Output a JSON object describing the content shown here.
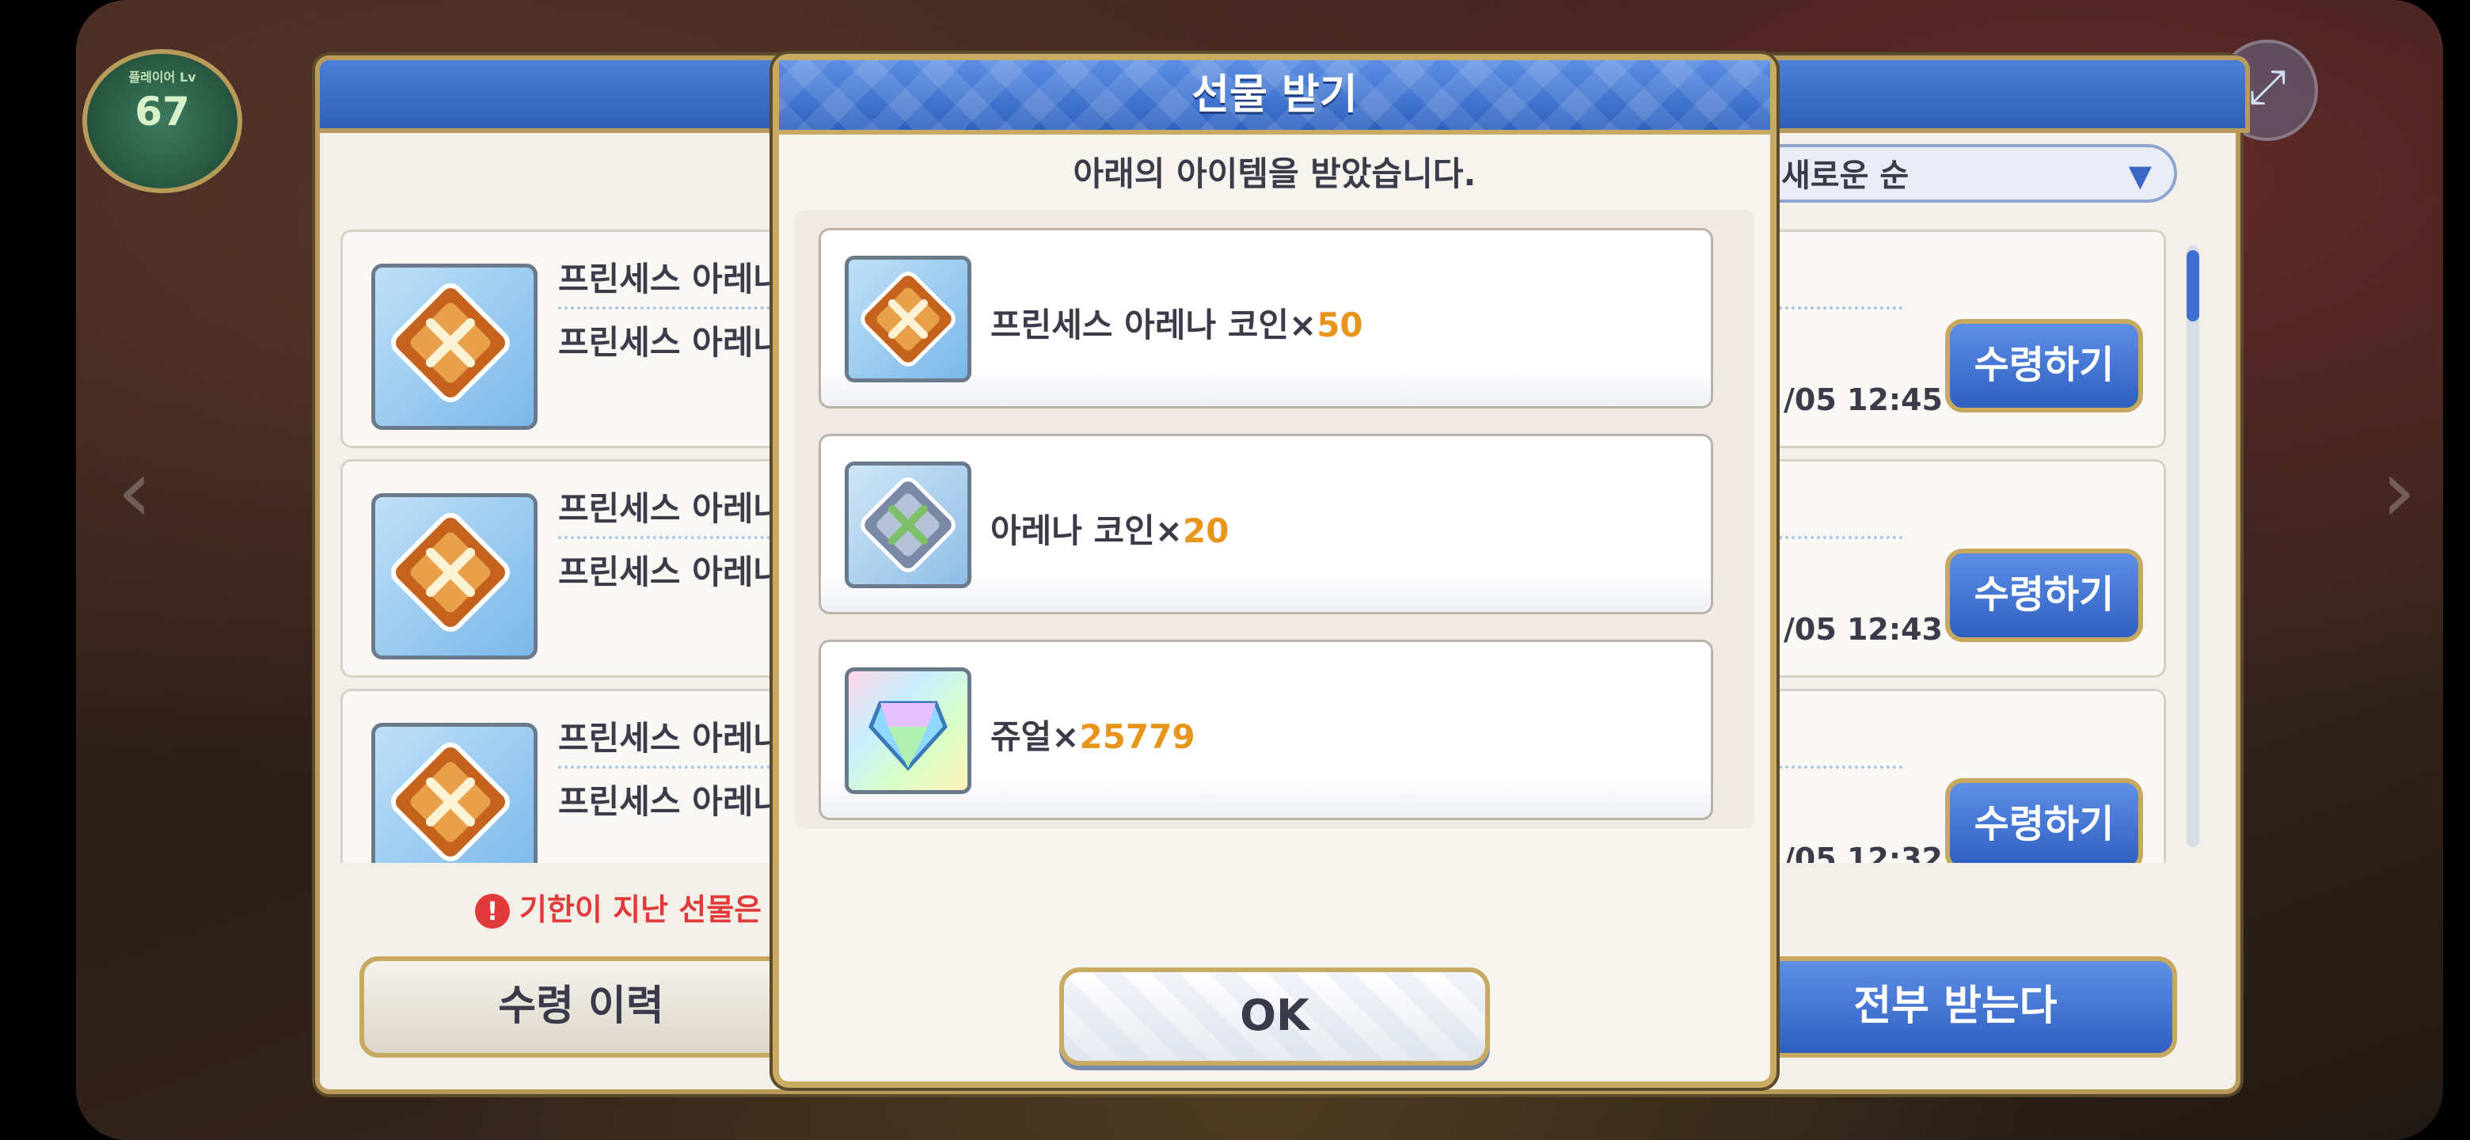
{
  "hud": {
    "level_caption": "플레이어 Lv",
    "level": "67"
  },
  "gift_box": {
    "sort_label": "새로운 순",
    "rows": [
      {
        "name": "프린세스 아레나",
        "name2": "프린세스 아레나",
        "date": "/05 12:45",
        "claim": "수령하기"
      },
      {
        "name": "프린세스 아레나",
        "name2": "프린세스 아레나",
        "date": "/05 12:43",
        "claim": "수령하기"
      },
      {
        "name": "프린세스 아레나",
        "name2": "프린세스 아레나",
        "date": "/05 12:32",
        "claim": "수령하기"
      }
    ],
    "expired_note": "기한이 지난 선물은 자",
    "history_button": "수령 이력",
    "claim_all_button": "전부 받는다"
  },
  "modal": {
    "title": "선물 받기",
    "subtitle": "아래의 아이템을 받았습니다.",
    "items": [
      {
        "name": "프린세스 아레나 코인×",
        "qty": "50",
        "icon": "princess-arena-coin-icon"
      },
      {
        "name": "아레나 코인×",
        "qty": "20",
        "icon": "arena-coin-icon"
      },
      {
        "name": "쥬얼×",
        "qty": "25779",
        "icon": "jewel-icon"
      }
    ],
    "ok_button": "OK"
  },
  "colors": {
    "header_blue": "#2e62c0",
    "gold_border": "#c8aa62",
    "quantity_orange": "#e8951e",
    "warning_red": "#e03a3a"
  }
}
